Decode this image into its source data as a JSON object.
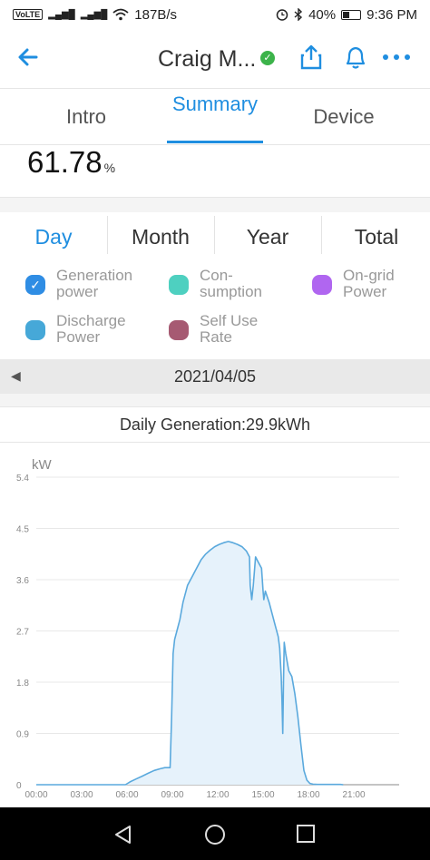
{
  "status_bar": {
    "volte": "VoLTE",
    "net_speed": "187B/s",
    "battery": "40%",
    "battery_level": 0.4,
    "time": "9:36 PM",
    "icons": [
      "signal-icon",
      "wifi-icon",
      "alarm-icon",
      "bluetooth-icon",
      "battery-icon"
    ]
  },
  "header": {
    "title": "Craig M...",
    "back_icon": "back-arrow-icon",
    "verified_icon": "check-circle-icon",
    "actions": [
      "share-icon",
      "bell-icon",
      "more-icon"
    ],
    "accent": "#1f8ee0"
  },
  "tabs": [
    {
      "label": "Intro",
      "active": false
    },
    {
      "label": "Summary",
      "active": true
    },
    {
      "label": "Device",
      "active": false
    }
  ],
  "summary": {
    "value": "61.78",
    "unit": "%"
  },
  "periods": [
    {
      "label": "Day",
      "active": true
    },
    {
      "label": "Month",
      "active": false
    },
    {
      "label": "Year",
      "active": false
    },
    {
      "label": "Total",
      "active": false
    }
  ],
  "legend": [
    {
      "label_lines": [
        "Generation",
        "power"
      ],
      "color": "#2f8de4",
      "checked": true
    },
    {
      "label_lines": [
        "Con-",
        "sumption"
      ],
      "color": "#4ed0c0",
      "checked": false
    },
    {
      "label_lines": [
        "On-grid",
        "Power"
      ],
      "color": "#b066f0",
      "checked": false
    },
    {
      "label_lines": [
        "Discharge",
        "Power"
      ],
      "color": "#46a8d8",
      "checked": false
    },
    {
      "label_lines": [
        "Self Use",
        "Rate"
      ],
      "color": "#a65a72",
      "checked": false
    }
  ],
  "date": {
    "value": "2021/04/05",
    "prev_icon": "triangle-left-icon"
  },
  "daily_generation": "Daily Generation:29.9kWh",
  "chart_data": {
    "type": "area",
    "ylabel": "kW",
    "ylim": [
      0,
      5.4
    ],
    "yticks": [
      "0",
      "0.9",
      "1.8",
      "2.7",
      "3.6",
      "4.5",
      "5.4"
    ],
    "xlim": [
      0,
      24
    ],
    "xticks": [
      "00:00",
      "03:00",
      "06:00",
      "09:00",
      "12:00",
      "15:00",
      "18:00",
      "21:00"
    ],
    "grid": true,
    "line_color": "#5aa9dd",
    "fill_color": "#e6f2fb",
    "series": [
      {
        "x": [
          0,
          5.9,
          6.2,
          6.6,
          7.0,
          7.4,
          7.8,
          8.2,
          8.5,
          8.7,
          8.85,
          8.95,
          9.05,
          9.15,
          9.3,
          9.5,
          9.7,
          10.0,
          10.3,
          10.6,
          10.9,
          11.2,
          11.5,
          11.8,
          12.1,
          12.4,
          12.7,
          13.0,
          13.3,
          13.6,
          13.9,
          14.1,
          14.15,
          14.25,
          14.35,
          14.5,
          14.7,
          14.9,
          15.0,
          15.05,
          15.15,
          15.4,
          15.6,
          15.8,
          16.0,
          16.1,
          16.2,
          16.25,
          16.3,
          16.35,
          16.4,
          16.5,
          16.7,
          16.9,
          17.1,
          17.3,
          17.5,
          17.7,
          17.9,
          18.1,
          18.3,
          18.6,
          20.1,
          20.3
        ],
        "y": [
          0,
          0,
          0.05,
          0.1,
          0.15,
          0.2,
          0.25,
          0.28,
          0.3,
          0.3,
          0.3,
          1.2,
          2.3,
          2.55,
          2.7,
          2.9,
          3.2,
          3.5,
          3.65,
          3.8,
          3.95,
          4.05,
          4.12,
          4.18,
          4.22,
          4.25,
          4.27,
          4.25,
          4.22,
          4.18,
          4.1,
          4.0,
          3.5,
          3.25,
          3.5,
          4.0,
          3.9,
          3.8,
          3.4,
          3.25,
          3.4,
          3.2,
          3.0,
          2.8,
          2.6,
          2.4,
          1.9,
          1.5,
          0.9,
          1.8,
          2.5,
          2.3,
          2.0,
          1.9,
          1.6,
          1.2,
          0.7,
          0.25,
          0.08,
          0.02,
          0.01,
          0.005,
          0.005,
          0
        ]
      }
    ]
  },
  "nav_bar": {
    "icons": [
      "back-triangle-icon",
      "home-circle-icon",
      "recents-square-icon"
    ]
  }
}
